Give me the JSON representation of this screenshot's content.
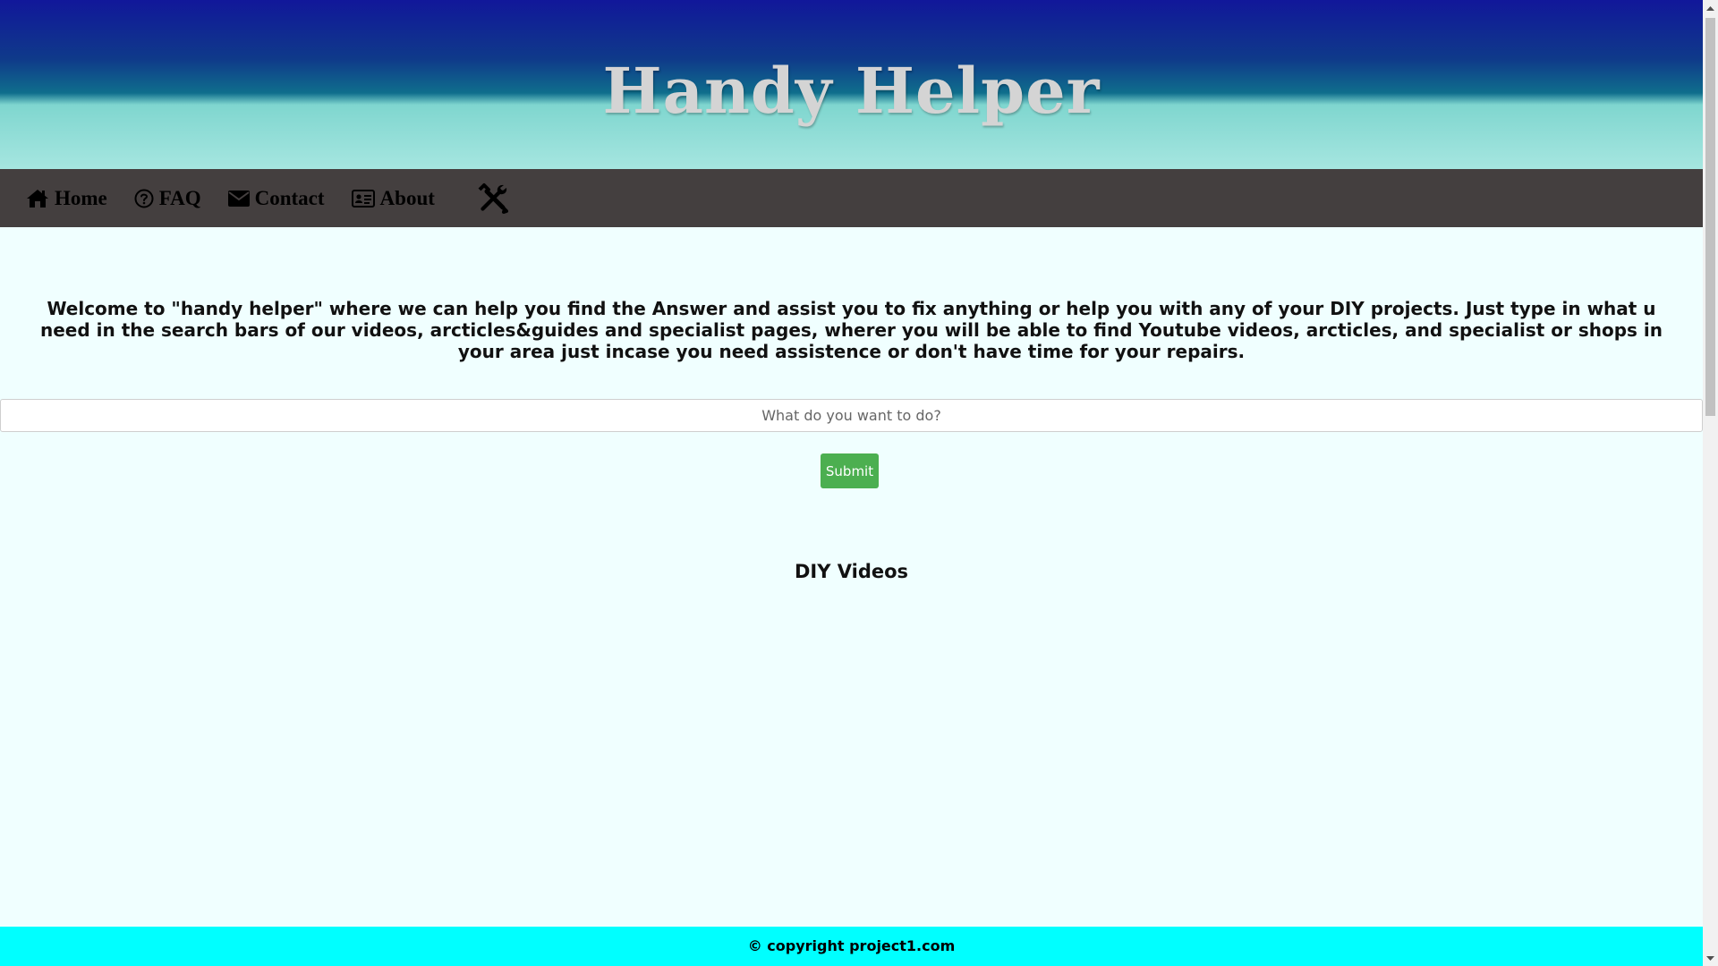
{
  "header": {
    "title": "Handy Helper"
  },
  "nav": {
    "items": [
      {
        "label": "Home",
        "icon": "home-icon"
      },
      {
        "label": "FAQ",
        "icon": "question-circle-icon"
      },
      {
        "label": "Contact",
        "icon": "envelope-icon"
      },
      {
        "label": "About",
        "icon": "id-card-icon"
      }
    ],
    "tools_icon": "tools-icon"
  },
  "main": {
    "intro": "Welcome to \"handy helper\" where we can help you find the Answer and assist you to fix anything or help you with any of your DIY projects. Just type in what u need in the search bars of our videos, arcticles&guides and specialist pages, wherer you will be able to find Youtube videos, arcticles, and specialist or shops in your area just incase you need assistence or don't have time for your repairs.",
    "search": {
      "placeholder": "What do you want to do?",
      "value": ""
    },
    "submit_label": "Submit",
    "section_heading": "DIY Videos"
  },
  "footer": {
    "text": "© copyright project1.com"
  },
  "colors": {
    "header_top": "#11179a",
    "header_bottom": "#a6e6e0",
    "navbar": "#443f3f",
    "page_background": "#f0ffff",
    "submit_button": "#4caf50",
    "footer": "#00ffff"
  }
}
